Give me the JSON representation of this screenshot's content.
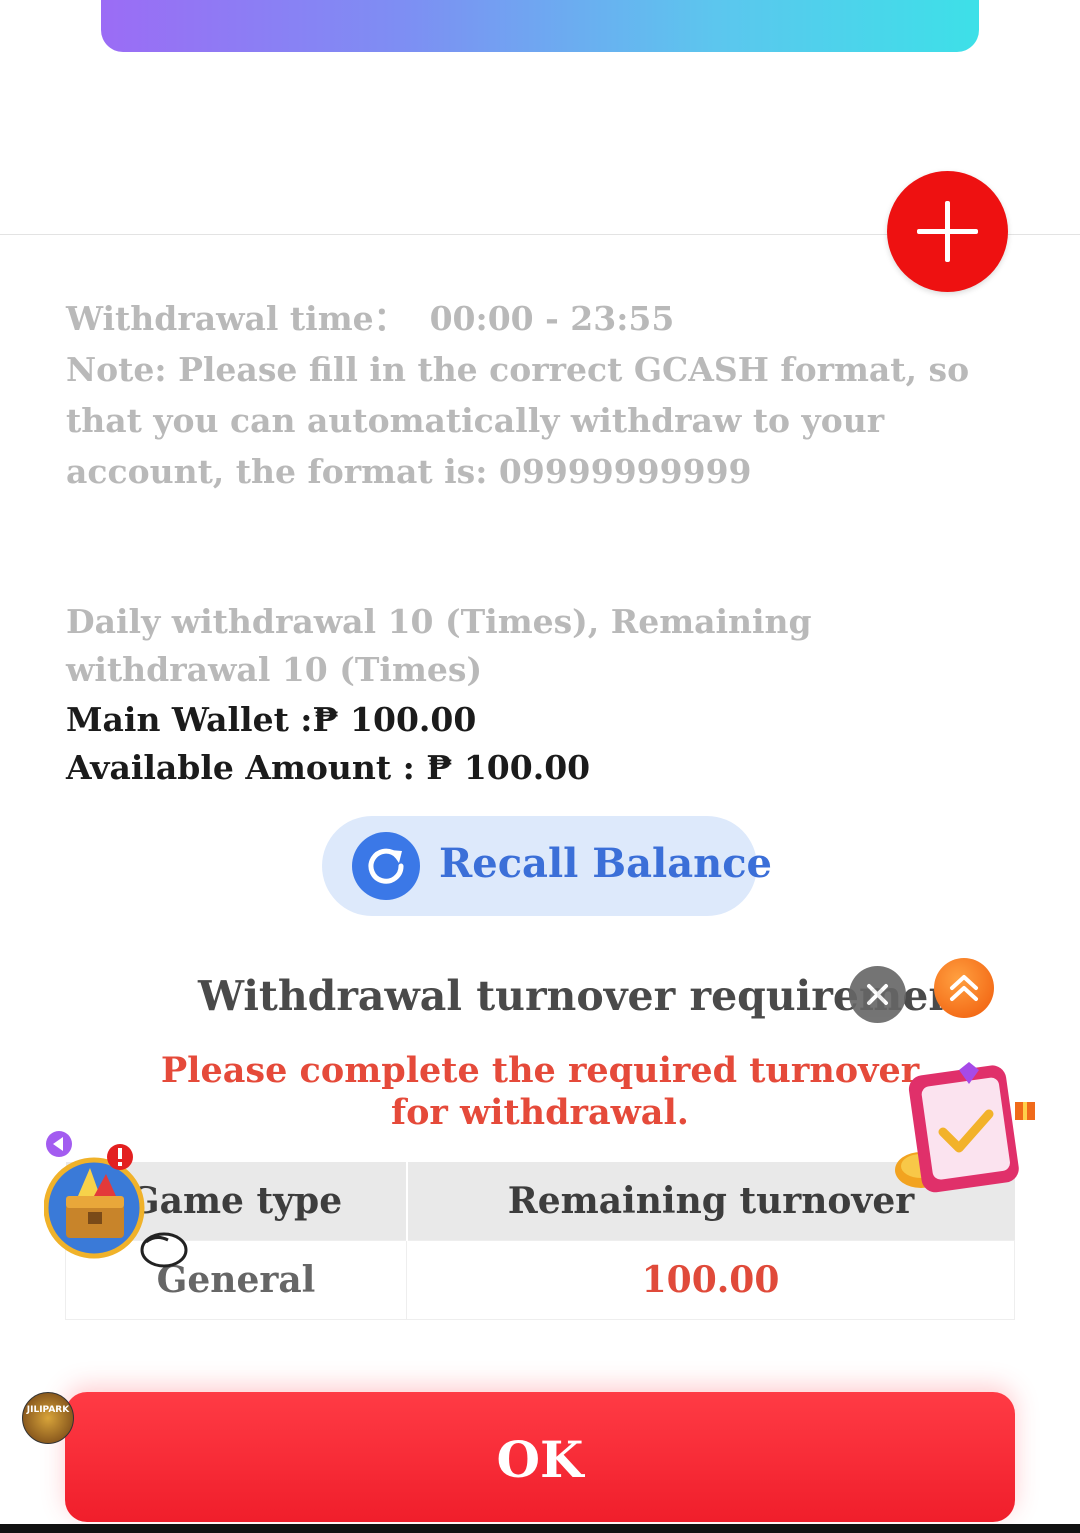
{
  "withdrawal_time": {
    "label": "Withdrawal time：",
    "value": "00:00 - 23:55"
  },
  "note": "Note: Please fill in the correct GCASH format, so that you can automatically withdraw to your account, the format is: 09999999999",
  "daily_limit": "Daily withdrawal 10 (Times), Remaining withdrawal 10 (Times)",
  "wallet": {
    "main_label": "Main Wallet :",
    "main_value": "₱ 100.00",
    "available_label": "Available Amount : ",
    "available_value": "₱ 100.00"
  },
  "recall_button": {
    "label": "Recall Balance",
    "icon": "refresh-icon"
  },
  "turnover": {
    "title": "Withdrawal turnover requirement",
    "warning": "Please complete the required turnover for withdrawal.",
    "columns": [
      "Game type",
      "Remaining turnover"
    ],
    "rows": [
      {
        "game_type": "General",
        "remaining": "100.00"
      }
    ]
  },
  "ok_button": {
    "label": "OK"
  },
  "app_logo": {
    "text": "JILIPARK"
  },
  "colors": {
    "accent_red": "#f01e2b",
    "recall_blue": "#3b78e7",
    "warning_red": "#e54a3a",
    "muted_text": "#b9b9b9"
  },
  "icons": {
    "add": "plus-icon",
    "close": "close-icon",
    "scroll_top": "double-chevron-up-icon",
    "game_promo": "treasure-chest-icon",
    "task_promo": "task-card-icon",
    "back": "back-arrow-icon",
    "alert": "alert-badge-icon"
  }
}
